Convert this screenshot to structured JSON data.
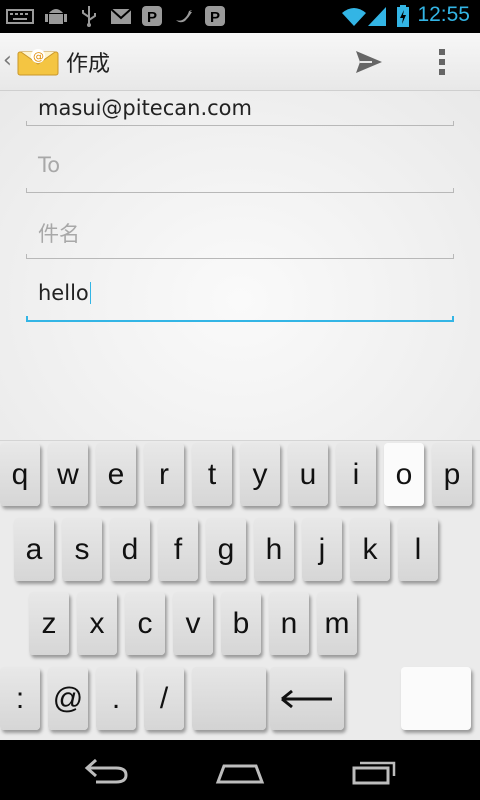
{
  "status_bar": {
    "time": "12:55",
    "icons": [
      "keyboard-icon",
      "android-debug-icon",
      "usb-icon",
      "gmail-icon",
      "pushbullet-icon",
      "twitter-icon",
      "pushbullet-icon",
      "wifi-icon",
      "signal-icon",
      "battery-icon"
    ],
    "accent": "#33b5e5"
  },
  "action_bar": {
    "title": "作成",
    "icons": [
      "email-app-icon",
      "send-icon",
      "overflow-menu-icon"
    ]
  },
  "compose": {
    "from": "masui@pitecan.com",
    "to_placeholder": "To",
    "subject_placeholder": "件名",
    "body": "hello"
  },
  "keyboard": {
    "rows": [
      [
        "q",
        "w",
        "e",
        "r",
        "t",
        "y",
        "u",
        "i",
        "o",
        "p"
      ],
      [
        "a",
        "s",
        "d",
        "f",
        "g",
        "h",
        "j",
        "k",
        "l"
      ],
      [
        "z",
        "x",
        "c",
        "v",
        "b",
        "n",
        "m"
      ],
      [
        ":",
        "@",
        ".",
        "/",
        "",
        "←",
        ""
      ]
    ],
    "highlighted_key": "o"
  },
  "nav_bar": {
    "icons": [
      "back-icon",
      "home-icon",
      "recent-apps-icon"
    ]
  }
}
